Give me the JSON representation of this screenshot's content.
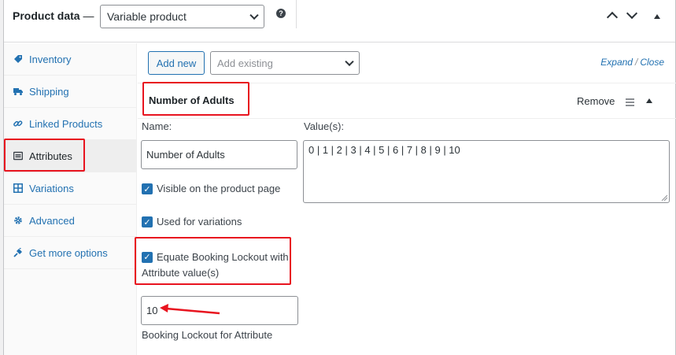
{
  "header": {
    "title": "Product data",
    "dash": " —",
    "product_type": "Variable product",
    "help": "?"
  },
  "sidebar": {
    "items": [
      {
        "label": "Inventory",
        "icon": "tag-icon"
      },
      {
        "label": "Shipping",
        "icon": "truck-icon"
      },
      {
        "label": "Linked Products",
        "icon": "link-icon"
      },
      {
        "label": "Attributes",
        "icon": "attributes-icon"
      },
      {
        "label": "Variations",
        "icon": "grid-icon"
      },
      {
        "label": "Advanced",
        "icon": "gear-icon"
      },
      {
        "label": "Get more options",
        "icon": "plugin-icon"
      }
    ]
  },
  "toolbar": {
    "add_new": "Add new",
    "add_existing_placeholder": "Add existing",
    "expand": "Expand",
    "slash": "/",
    "close": "Close"
  },
  "attribute": {
    "title": "Number of Adults",
    "remove": "Remove",
    "name_label": "Name:",
    "name_value": "Number of Adults",
    "values_label": "Value(s):",
    "values": "0 | 1 | 2 | 3 | 4 | 5 | 6 | 7 | 8 | 9 | 10",
    "visible_label": "Visible on the product page",
    "variations_label": "Used for variations",
    "equate_label_1": "Equate Booking Lockout with",
    "equate_label_2": "Attribute value(s)",
    "lockout_value": "10",
    "lockout_label": "Booking Lockout for Attribute"
  },
  "colors": {
    "accent": "#2271b1",
    "highlight": "#e8141f"
  }
}
